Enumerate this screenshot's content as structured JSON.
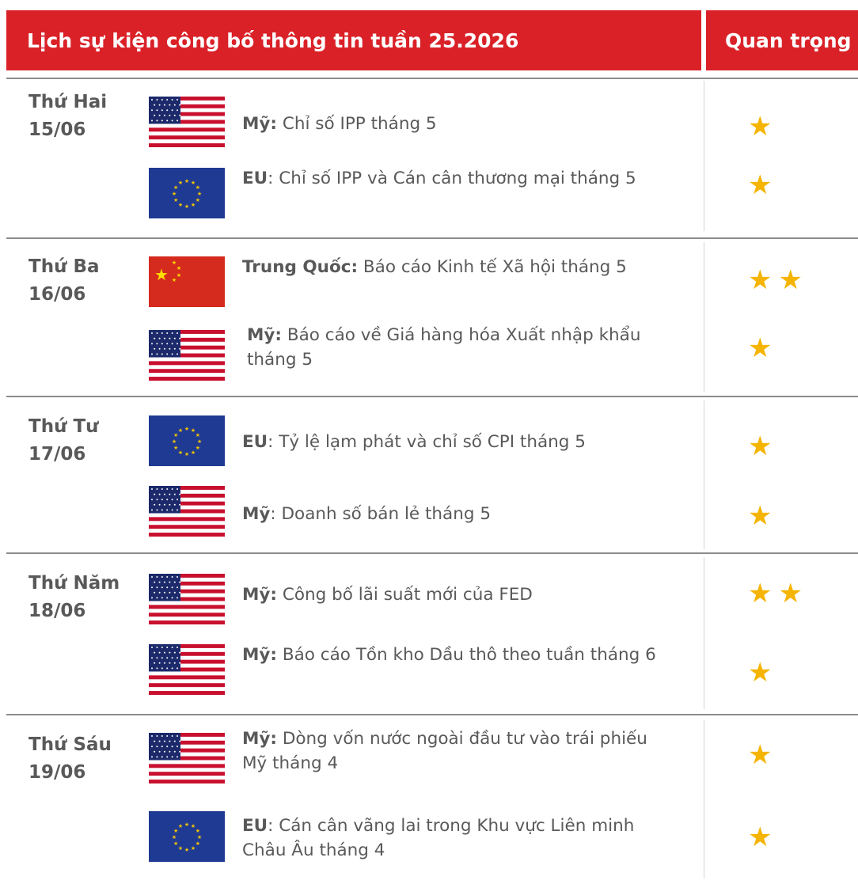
{
  "header": {
    "title": "Lịch sự kiện công bố thông tin tuần 25.2026",
    "importance": "Quan trọng"
  },
  "colors": {
    "header_bg": "#da2128",
    "star": "#f5b400"
  },
  "days": [
    {
      "name": "Thứ Hai",
      "date": "15/06",
      "events": [
        {
          "flag": "us-flag-icon",
          "country": "Mỹ:",
          "text": " Chỉ số IPP tháng 5",
          "stars": "★",
          "star_count": 1
        },
        {
          "flag": "eu-flag-icon",
          "country": "EU",
          "text": ": Chỉ số IPP và Cán cân thương mại tháng 5",
          "stars": "★",
          "star_count": 1
        }
      ]
    },
    {
      "name": "Thứ Ba",
      "date": "16/06",
      "events": [
        {
          "flag": "cn-flag-icon",
          "country": "Trung Quốc:",
          "text": " Báo cáo Kinh tế Xã hội tháng 5",
          "stars": "★★",
          "star_count": 2
        },
        {
          "flag": "us-flag-icon",
          "country": "Mỹ:",
          "text": " Báo cáo về Giá hàng hóa Xuất nhập khẩu tháng 5",
          "stars": "★",
          "star_count": 1
        }
      ]
    },
    {
      "name": "Thứ Tư",
      "date": "17/06",
      "events": [
        {
          "flag": "eu-flag-icon",
          "country": "EU",
          "text": ": Tỷ lệ lạm phát và chỉ số CPI tháng 5",
          "stars": "★",
          "star_count": 1
        },
        {
          "flag": "us-flag-icon",
          "country": "Mỹ",
          "text": ": Doanh số bán lẻ tháng 5",
          "stars": "★",
          "star_count": 1
        }
      ]
    },
    {
      "name": "Thứ Năm",
      "date": "18/06",
      "events": [
        {
          "flag": "us-flag-icon",
          "country": "Mỹ:",
          "text": " Công bố lãi suất mới của FED",
          "stars": "★★",
          "star_count": 2
        },
        {
          "flag": "us-flag-icon",
          "country": "Mỹ:",
          "text": " Báo cáo Tồn kho Dầu thô theo tuần tháng 6",
          "stars": "★",
          "star_count": 1
        }
      ]
    },
    {
      "name": "Thứ Sáu",
      "date": "19/06",
      "events": [
        {
          "flag": "us-flag-icon",
          "country": "Mỹ:",
          "text": " Dòng vốn nước ngoài đầu tư vào trái phiếu Mỹ tháng 4",
          "stars": "★",
          "star_count": 1
        },
        {
          "flag": "eu-flag-icon",
          "country": "EU",
          "text": ": Cán cân vãng lai trong Khu vực Liên minh Châu Âu tháng 4",
          "stars": "★",
          "star_count": 1
        }
      ]
    }
  ]
}
